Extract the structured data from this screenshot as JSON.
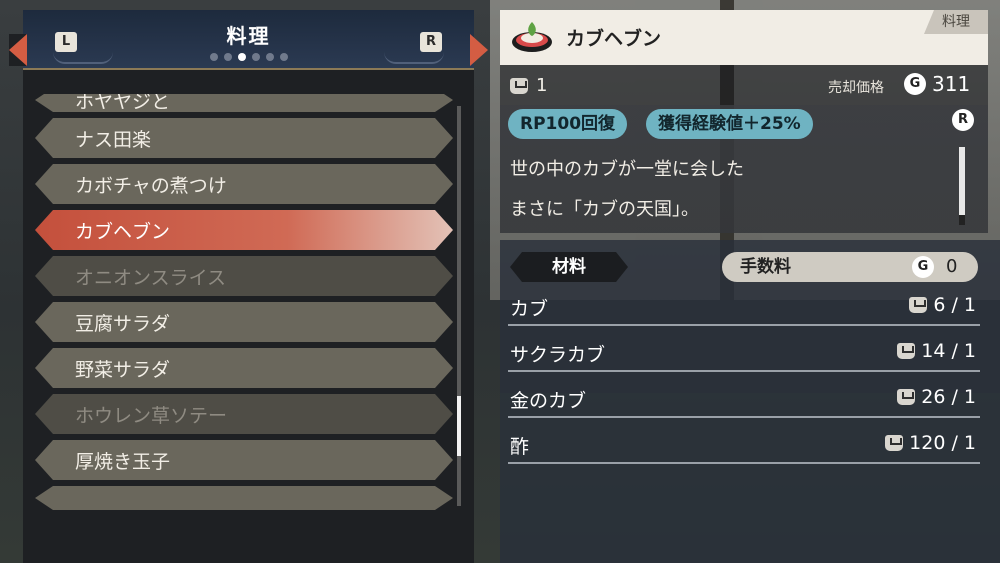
{
  "left_panel": {
    "title": "料理",
    "left_key": "L",
    "right_key": "R",
    "page_dots": 6,
    "active_page_index": 2,
    "items": [
      {
        "label": "ホヤヤジと",
        "state": "partial"
      },
      {
        "label": "ナス田楽",
        "state": "normal"
      },
      {
        "label": "カボチャの煮つけ",
        "state": "normal"
      },
      {
        "label": "カブヘブン",
        "state": "selected"
      },
      {
        "label": "オニオンスライス",
        "state": "dim"
      },
      {
        "label": "豆腐サラダ",
        "state": "normal"
      },
      {
        "label": "野菜サラダ",
        "state": "normal"
      },
      {
        "label": "ホウレン草ソテー",
        "state": "dim"
      },
      {
        "label": "厚焼き玉子",
        "state": "normal"
      },
      {
        "label": "",
        "state": "partial"
      }
    ]
  },
  "detail": {
    "category": "料理",
    "name": "カブヘブン",
    "owned": "1",
    "sell_price_label": "売却価格",
    "currency_symbol": "G",
    "sell_price": "311",
    "effects": [
      "RP100回復",
      "獲得経験値＋25%"
    ],
    "scroll_key": "R",
    "description": [
      "世の中のカブが一堂に会した",
      "まさに「カブの天国」。"
    ]
  },
  "materials": {
    "header": "材料",
    "fee_label": "手数料",
    "fee_currency": "G",
    "fee_value": "0",
    "rows": [
      {
        "name": "カブ",
        "count": "6 / 1"
      },
      {
        "name": "サクラカブ",
        "count": "14 / 1"
      },
      {
        "name": "金のカブ",
        "count": "26 / 1"
      },
      {
        "name": "酢",
        "count": "120 / 1"
      }
    ]
  },
  "colors": {
    "selected_accent": "#c4503c",
    "effect_tag": "#6fb3c2",
    "header_navy": "#1d2a3d"
  }
}
